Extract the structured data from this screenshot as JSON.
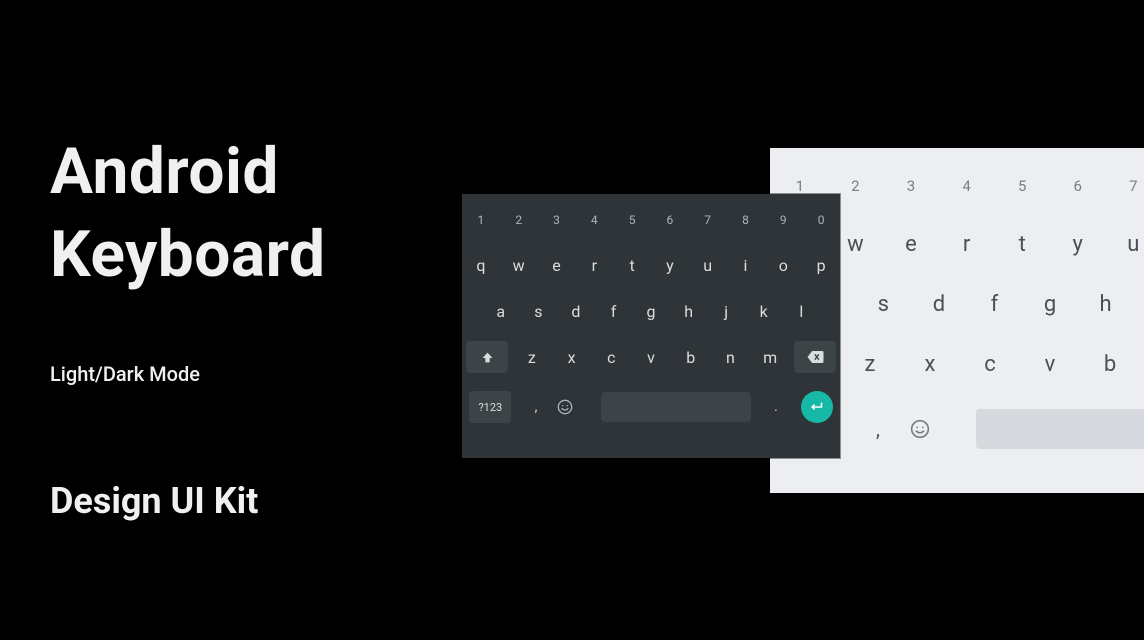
{
  "text": {
    "title_line1": "Android",
    "title_line2": "Keyboard",
    "subtitle": "Light/Dark Mode",
    "footer": "Design UI Kit"
  },
  "keyboard": {
    "numbers": [
      "1",
      "2",
      "3",
      "4",
      "5",
      "6",
      "7",
      "8",
      "9",
      "0"
    ],
    "row1": [
      "q",
      "w",
      "e",
      "r",
      "t",
      "y",
      "u",
      "i",
      "o",
      "p"
    ],
    "row2": [
      "a",
      "s",
      "d",
      "f",
      "g",
      "h",
      "j",
      "k",
      "l"
    ],
    "row3": [
      "z",
      "x",
      "c",
      "v",
      "b",
      "n",
      "m"
    ],
    "sym_label": "?123",
    "comma": ",",
    "period": ".",
    "colors": {
      "dark_bg": "#2e3438",
      "dark_mod": "#3d4448",
      "light_bg": "#eceef1",
      "light_mod": "#d2d5da",
      "accent": "#17b8a6"
    }
  }
}
